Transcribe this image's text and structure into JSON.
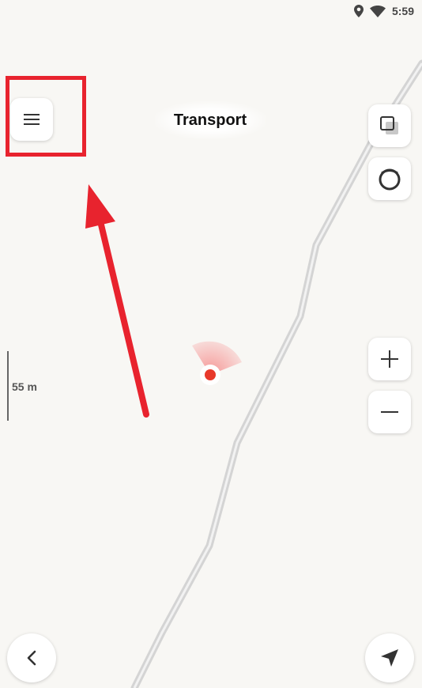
{
  "status_bar": {
    "time": "5:59",
    "icons": [
      "location-pin-icon",
      "wifi-icon"
    ]
  },
  "header": {
    "title": "Transport"
  },
  "map": {
    "scale_label": "55 m",
    "marker_color": "#e8392b"
  },
  "controls": {
    "menu_icon": "hamburger-menu-icon",
    "layers_icon": "layers-icon",
    "compass_icon": "compass-icon",
    "zoom_in_label": "+",
    "zoom_out_label": "−",
    "back_icon": "chevron-left-icon",
    "navigate_icon": "navigation-arrow-icon"
  },
  "annotation": {
    "color": "#e8232e",
    "highlight_target": "menu-button"
  }
}
